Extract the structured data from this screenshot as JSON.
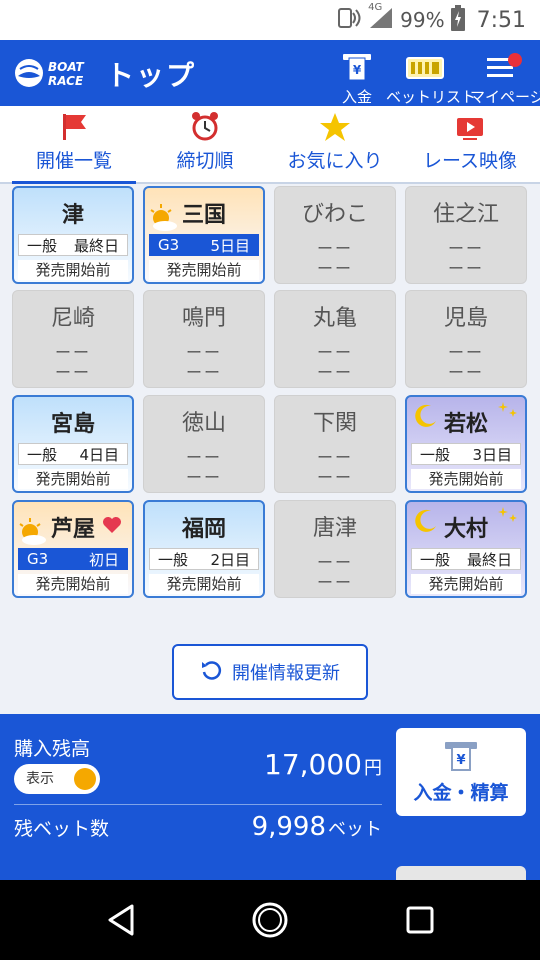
{
  "status_bar": {
    "network": "4G",
    "battery": "99%",
    "time": "7:51"
  },
  "header": {
    "logo_line1": "BOAT",
    "logo_line2": "RACE",
    "title": "トップ",
    "buttons": [
      {
        "label": "入金",
        "icon": "deposit-icon"
      },
      {
        "label": "ベットリスト",
        "icon": "ticket-icon"
      },
      {
        "label": "マイページ",
        "icon": "menu-icon"
      }
    ]
  },
  "tabs": [
    {
      "label": "開催一覧",
      "icon": "flag-icon",
      "active": true
    },
    {
      "label": "締切順",
      "icon": "alarm-clock-icon",
      "active": false
    },
    {
      "label": "お気に入り",
      "icon": "star-icon",
      "active": false
    },
    {
      "label": "レース映像",
      "icon": "video-icon",
      "active": false
    }
  ],
  "venues": [
    {
      "name": "津",
      "grade": "一般",
      "day": "最終日",
      "status": "発売開始前",
      "theme": "day"
    },
    {
      "name": "三国",
      "grade": "G3",
      "day": "5日目",
      "status": "発売開始前",
      "theme": "morning"
    },
    {
      "name": "びわこ",
      "dash": "ーー"
    },
    {
      "name": "住之江",
      "dash": "ーー"
    },
    {
      "name": "尼崎",
      "dash": "ーー"
    },
    {
      "name": "鳴門",
      "dash": "ーー"
    },
    {
      "name": "丸亀",
      "dash": "ーー"
    },
    {
      "name": "児島",
      "dash": "ーー"
    },
    {
      "name": "宮島",
      "grade": "一般",
      "day": "4日目",
      "status": "発売開始前",
      "theme": "day"
    },
    {
      "name": "徳山",
      "dash": "ーー"
    },
    {
      "name": "下関",
      "dash": "ーー"
    },
    {
      "name": "若松",
      "grade": "一般",
      "day": "3日目",
      "status": "発売開始前",
      "theme": "night"
    },
    {
      "name": "芦屋",
      "grade": "G3",
      "day": "初日",
      "status": "発売開始前",
      "theme": "morning"
    },
    {
      "name": "福岡",
      "grade": "一般",
      "day": "2日目",
      "status": "発売開始前",
      "theme": "day"
    },
    {
      "name": "唐津",
      "dash": "ーー"
    },
    {
      "name": "大村",
      "grade": "一般",
      "day": "最終日",
      "status": "発売開始前",
      "theme": "night"
    }
  ],
  "refresh_label": "開催情報更新",
  "balance": {
    "label": "購入残高",
    "toggle_label": "表示",
    "amount": "17,000",
    "unit": "円",
    "bets_label": "残ベット数",
    "bets_amount": "9,998",
    "bets_unit": "ベット",
    "deposit_label": "入金・精算"
  },
  "colors": {
    "primary": "#1a56d6",
    "accent": "#f5a800",
    "notification": "#e8303a"
  }
}
